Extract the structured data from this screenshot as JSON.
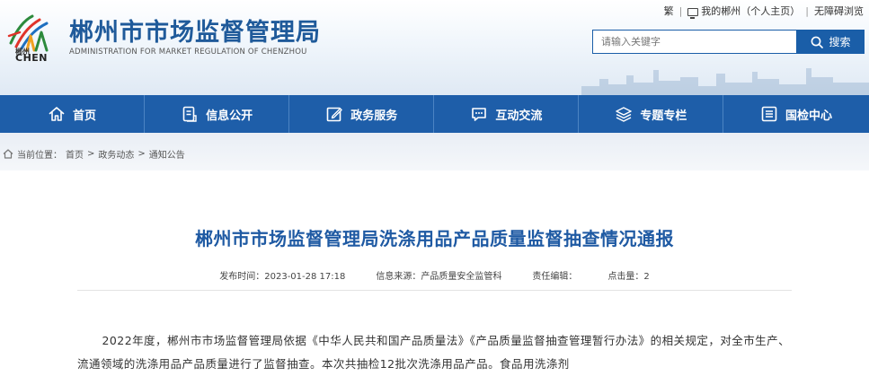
{
  "header": {
    "logo_small": "郴州",
    "logo_en": "CHEN",
    "site_title": "郴州市市场监督管理局",
    "site_subtitle": "ADMINISTRATION FOR MARKET REGULATION OF CHENZHOU",
    "top_links": [
      "繁",
      "我的郴州（个人主页）",
      "无障碍浏览"
    ],
    "search_placeholder": "请输入关键字",
    "search_button": "搜索"
  },
  "nav": {
    "items": [
      {
        "label": "首页",
        "icon": "home-icon"
      },
      {
        "label": "信息公开",
        "icon": "document-icon"
      },
      {
        "label": "政务服务",
        "icon": "edit-icon"
      },
      {
        "label": "互动交流",
        "icon": "chat-icon"
      },
      {
        "label": "专题专栏",
        "icon": "layers-icon"
      },
      {
        "label": "国检中心",
        "icon": "list-icon"
      }
    ]
  },
  "breadcrumb": {
    "prefix": "当前位置：",
    "items": [
      "首页",
      "政务动态",
      "通知公告"
    ],
    "separator": ">"
  },
  "article": {
    "title": "郴州市市场监督管理局洗涤用品产品质量监督抽查情况通报",
    "meta": {
      "publish_label": "发布时间：",
      "publish_time": "2023-01-28 17:18",
      "source_label": "信息来源：",
      "source": "产品质量安全监管科",
      "editor_label": "责任编辑：",
      "editor": "",
      "views_label": "点击量：",
      "views": "2"
    },
    "paragraph": "2022年度，郴州市市场监督管理局依据《中华人民共和国产品质量法》《产品质量监督抽查管理暂行办法》的相关规定，对全市生产、流通领域的洗涤用品产品质量进行了监督抽查。本次共抽检12批次洗涤用品产品。食品用洗涤剂"
  },
  "colors": {
    "brand_blue": "#1e5ea9",
    "title_blue": "#1f5aa3"
  }
}
